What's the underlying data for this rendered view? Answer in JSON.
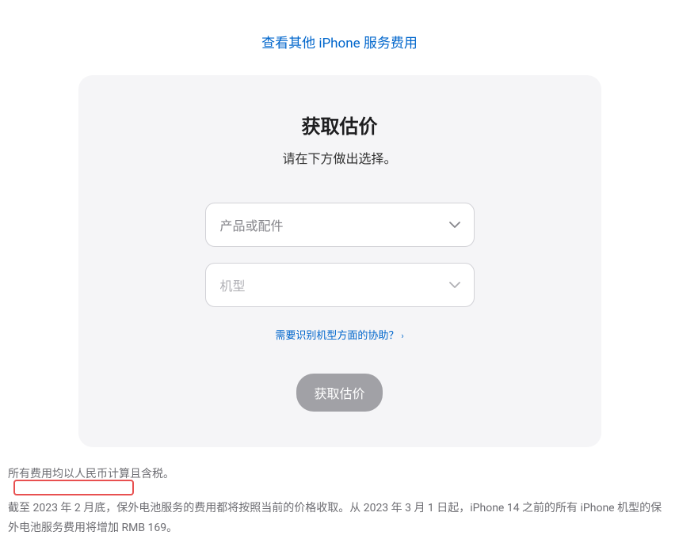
{
  "topLink": {
    "label": "查看其他 iPhone 服务费用"
  },
  "card": {
    "title": "获取估价",
    "subtitle": "请在下方做出选择。",
    "productSelect": {
      "placeholder": "产品或配件"
    },
    "modelSelect": {
      "placeholder": "机型"
    },
    "helpLink": {
      "label": "需要识别机型方面的协助？"
    },
    "submitButton": {
      "label": "获取估价"
    }
  },
  "footer": {
    "note1": "所有费用均以人民币计算且含税。",
    "note2": "截至 2023 年 2 月底，保外电池服务的费用都将按照当前的价格收取。从 2023 年 3 月 1 日起，iPhone 14 之前的所有 iPhone 机型的保外电池服务费用将增加 RMB 169。"
  }
}
